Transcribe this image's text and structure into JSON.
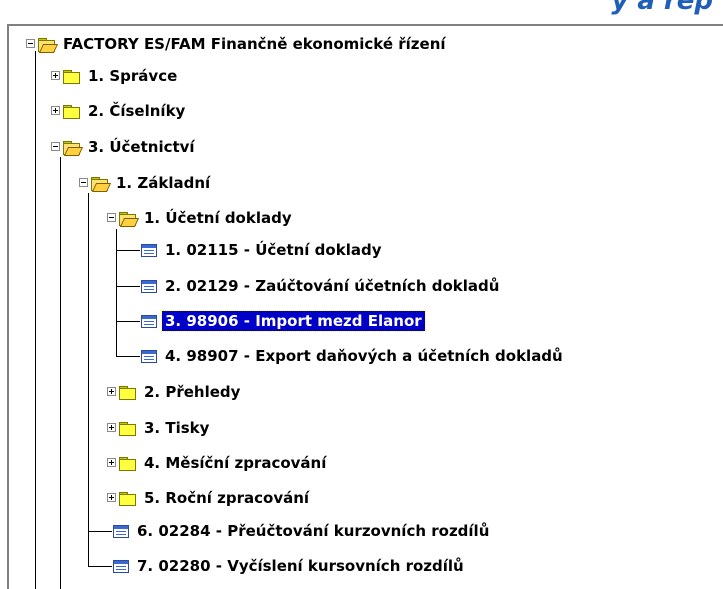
{
  "header": {
    "title_fragment": "y a rep"
  },
  "tree": [
    {
      "id": "root",
      "label": "FACTORY ES/FAM Finančně ekonomické řízení",
      "type": "folder",
      "expanded": true,
      "level": 0
    },
    {
      "id": "spravce",
      "label": "1. Správce",
      "type": "folder",
      "expanded": false,
      "level": 1
    },
    {
      "id": "ciselniky",
      "label": "2. Číselníky",
      "type": "folder",
      "expanded": false,
      "level": 1
    },
    {
      "id": "ucetnictvi",
      "label": "3. Účetnictví",
      "type": "folder",
      "expanded": true,
      "level": 1
    },
    {
      "id": "zakladni",
      "label": "1. Základní",
      "type": "folder",
      "expanded": true,
      "level": 2
    },
    {
      "id": "ucetni-doklady",
      "label": "1. Účetní doklady",
      "type": "folder",
      "expanded": true,
      "level": 3
    },
    {
      "id": "d02115",
      "label": "1. 02115 - Účetní doklady",
      "type": "form",
      "level": 4
    },
    {
      "id": "d02129",
      "label": "2. 02129 - Zaúčtování účetních dokladů",
      "type": "form",
      "level": 4
    },
    {
      "id": "d98906",
      "label": "3. 98906 - Import mezd Elanor",
      "type": "form",
      "level": 4,
      "selected": true
    },
    {
      "id": "d98907",
      "label": "4. 98907 - Export daňových a účetních dokladů",
      "type": "form",
      "level": 4
    },
    {
      "id": "prehledy",
      "label": "2. Přehledy",
      "type": "folder",
      "expanded": false,
      "level": 3
    },
    {
      "id": "tisky",
      "label": "3. Tisky",
      "type": "folder",
      "expanded": false,
      "level": 3
    },
    {
      "id": "mesicni",
      "label": "4. Měsíční zpracování",
      "type": "folder",
      "expanded": false,
      "level": 3
    },
    {
      "id": "rocni",
      "label": "5. Roční zpracování",
      "type": "folder",
      "expanded": false,
      "level": 3
    },
    {
      "id": "d02284",
      "label": "6. 02284 - Přeúčtování kurzovních rozdílů",
      "type": "form",
      "level": 3
    },
    {
      "id": "d02280",
      "label": "7. 02280 - Vyčíslení kursovních rozdílů",
      "type": "form",
      "level": 3
    }
  ],
  "colors": {
    "selection": "#0000c8",
    "folder": "#ffff40",
    "header_text": "#1f5fb8"
  }
}
